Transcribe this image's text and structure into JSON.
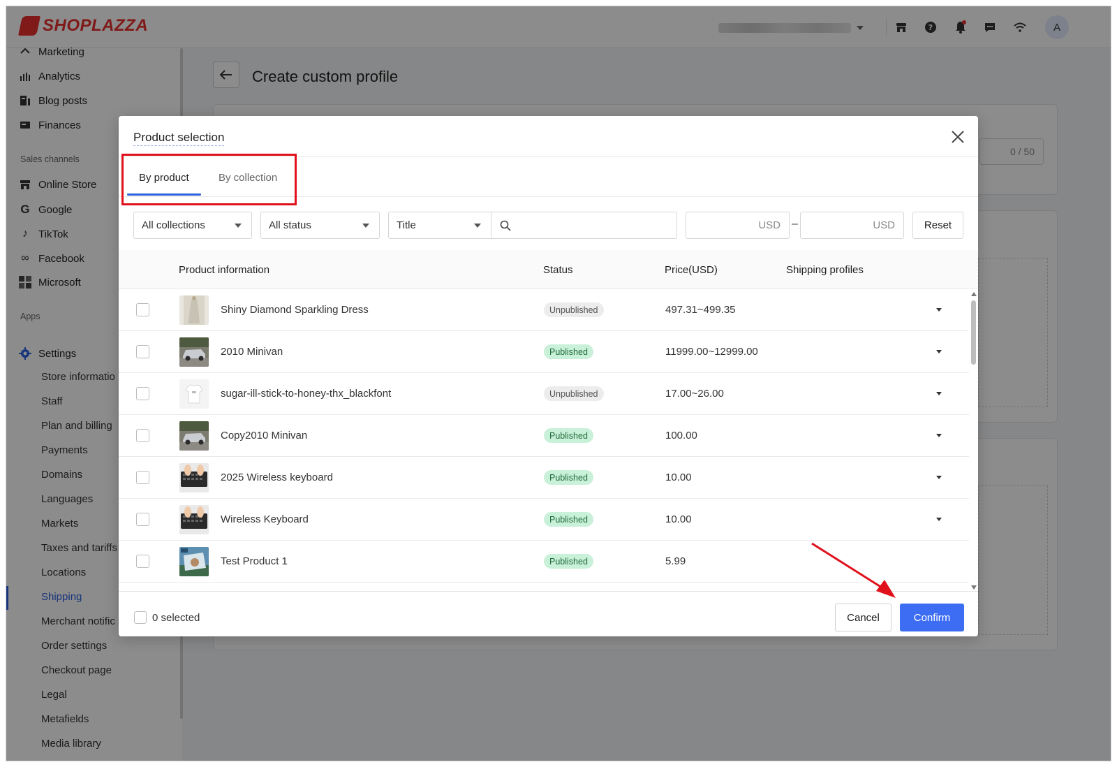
{
  "app": {
    "brand": "SHOPLAZZA",
    "avatar_letter": "A"
  },
  "topbar": {
    "icons": [
      "store-icon",
      "help-icon",
      "bell-icon",
      "chat-icon",
      "wifi-icon"
    ]
  },
  "sidebar": {
    "items_top": [
      {
        "label": "Marketing",
        "icon": "marketing-icon"
      },
      {
        "label": "Analytics",
        "icon": "analytics-icon"
      },
      {
        "label": "Blog posts",
        "icon": "blog-icon"
      },
      {
        "label": "Finances",
        "icon": "finances-icon"
      }
    ],
    "sales_channels_heading": "Sales channels",
    "channels": [
      {
        "label": "Online Store",
        "icon": "store-icon"
      },
      {
        "label": "Google",
        "icon": "google-icon"
      },
      {
        "label": "TikTok",
        "icon": "tiktok-icon"
      },
      {
        "label": "Facebook",
        "icon": "meta-icon"
      },
      {
        "label": "Microsoft",
        "icon": "microsoft-icon"
      }
    ],
    "apps_heading": "Apps",
    "settings_label": "Settings",
    "settings_items": [
      "Store informatio",
      "Staff",
      "Plan and billing",
      "Payments",
      "Domains",
      "Languages",
      "Markets",
      "Taxes and tariffs",
      "Locations",
      "Shipping",
      "Merchant notific",
      "Order settings",
      "Checkout page",
      "Legal",
      "Metafields",
      "Media library"
    ],
    "active_item": "Shipping"
  },
  "page": {
    "title": "Create custom profile",
    "counter": "0 / 50"
  },
  "modal": {
    "title": "Product selection",
    "tabs": [
      "By product",
      "By collection"
    ],
    "active_tab": "By product",
    "filters": {
      "collections": "All collections",
      "status": "All status",
      "search_field": "Title",
      "currency_min": "USD",
      "currency_max": "USD",
      "reset": "Reset",
      "range_separator": "–"
    },
    "columns": [
      "Product information",
      "Status",
      "Price(USD)",
      "Shipping profiles"
    ],
    "rows": [
      {
        "name": "Shiny Diamond Sparkling Dress",
        "status": "Unpublished",
        "price": "497.31~499.35",
        "has_dropdown": true,
        "thumb": "dress"
      },
      {
        "name": "2010 Minivan",
        "status": "Published",
        "price": "11999.00~12999.00",
        "has_dropdown": true,
        "thumb": "car"
      },
      {
        "name": "sugar-ill-stick-to-honey-thx_blackfont",
        "status": "Unpublished",
        "price": "17.00~26.00",
        "has_dropdown": true,
        "thumb": "tshirt"
      },
      {
        "name": "Copy2010 Minivan",
        "status": "Published",
        "price": "100.00",
        "has_dropdown": true,
        "thumb": "car"
      },
      {
        "name": "2025 Wireless keyboard",
        "status": "Published",
        "price": "10.00",
        "has_dropdown": true,
        "thumb": "keyboard"
      },
      {
        "name": "Wireless Keyboard",
        "status": "Published",
        "price": "10.00",
        "has_dropdown": true,
        "thumb": "keyboard"
      },
      {
        "name": "Test Product 1",
        "status": "Published",
        "price": "5.99",
        "has_dropdown": false,
        "thumb": "travel"
      }
    ],
    "footer": {
      "selected_text": "0 selected",
      "cancel": "Cancel",
      "confirm": "Confirm"
    }
  },
  "colors": {
    "accent": "#3d6df2",
    "brand": "#e7312e",
    "highlight": "#e0111b",
    "published_bg": "#c9f0d8"
  }
}
